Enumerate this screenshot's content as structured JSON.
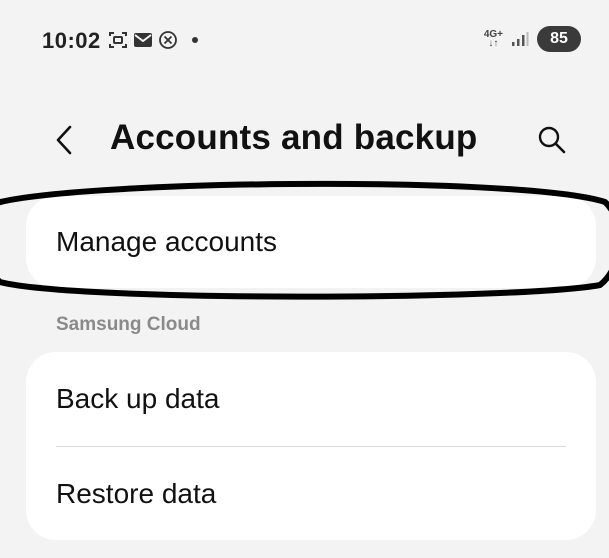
{
  "status_bar": {
    "time": "10:02",
    "network_type_top": "4G+",
    "network_type_bottom": "↓↑",
    "battery": "85",
    "notification_icons": [
      "screenshot-icon",
      "mail-icon",
      "blocked-icon"
    ]
  },
  "header": {
    "title": "Accounts and backup",
    "back_icon": "chevron-left-icon",
    "search_icon": "search-icon"
  },
  "manage_accounts": {
    "label": "Manage accounts"
  },
  "samsung_cloud": {
    "section_label": "Samsung Cloud",
    "items": [
      {
        "label": "Back up data"
      },
      {
        "label": "Restore data"
      }
    ]
  },
  "colors": {
    "background": "#f3f3f3",
    "card": "#ffffff",
    "section_label": "#8a8a8a",
    "annotation": "#000000"
  }
}
